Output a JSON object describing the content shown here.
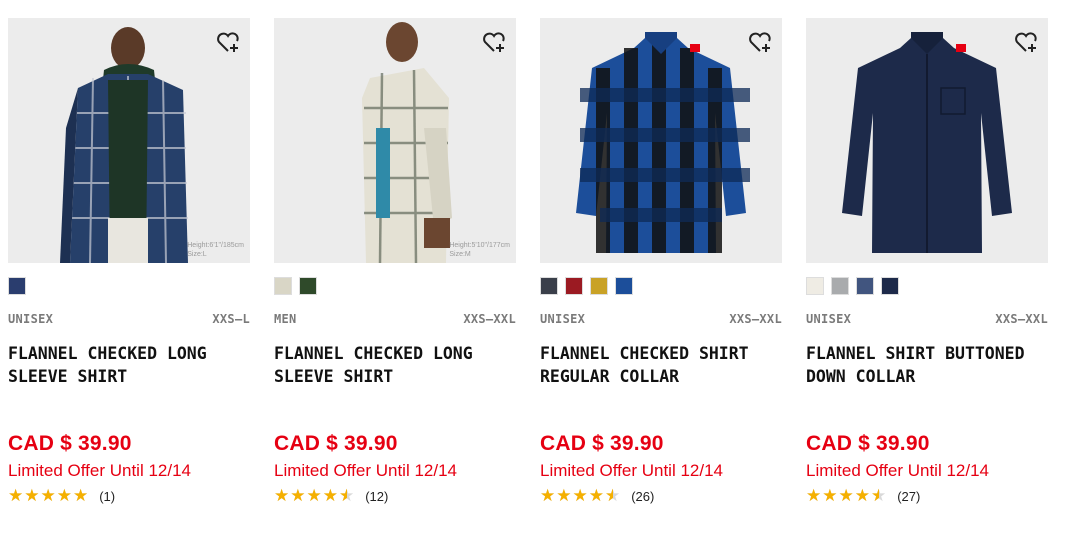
{
  "products": [
    {
      "gender": "UNISEX",
      "sizes": "XXS–L",
      "name": "FLANNEL CHECKED LONG SLEEVE SHIRT",
      "price": "CAD $ 39.90",
      "offer": "Limited Offer Until 12/14",
      "rating": 5,
      "review_count": "(1)",
      "model_height": "Height:6'1\"/185cm",
      "model_size": "Size:L",
      "swatches": [
        "#2a3d6e"
      ],
      "image": "model-navy-plaid"
    },
    {
      "gender": "MEN",
      "sizes": "XXS–XXL",
      "name": "FLANNEL CHECKED LONG SLEEVE SHIRT",
      "price": "CAD $ 39.90",
      "offer": "Limited Offer Until 12/14",
      "rating": 4.5,
      "review_count": "(12)",
      "model_height": "Height:5'10\"/177cm",
      "model_size": "Size:M",
      "swatches": [
        "#d9d6c6",
        "#2f4a2a"
      ],
      "image": "model-cream-plaid"
    },
    {
      "gender": "UNISEX",
      "sizes": "XXS–XXL",
      "name": "FLANNEL CHECKED SHIRT REGULAR COLLAR",
      "price": "CAD $ 39.90",
      "offer": "Limited Offer Until 12/14",
      "rating": 4.5,
      "review_count": "(26)",
      "model_height": "",
      "model_size": "",
      "swatches": [
        "#3a3f4a",
        "#9b1a22",
        "#c9a227",
        "#1c4e9a"
      ],
      "image": "shirt-blue-buffalo-check"
    },
    {
      "gender": "UNISEX",
      "sizes": "XXS–XXL",
      "name": "FLANNEL SHIRT BUTTONED DOWN COLLAR",
      "price": "CAD $ 39.90",
      "offer": "Limited Offer Until 12/14",
      "rating": 4.5,
      "review_count": "(27)",
      "model_height": "",
      "model_size": "",
      "swatches": [
        "#efece4",
        "#a9abad",
        "#41557f",
        "#1d2a4a"
      ],
      "image": "shirt-navy-solid"
    }
  ],
  "colors": {
    "sale_red": "#e60012",
    "star_gold": "#f5b000",
    "meta_gray": "#7a7a7a"
  },
  "icons": {
    "wishlist": "heart-plus-icon",
    "rating": "star-icon"
  }
}
